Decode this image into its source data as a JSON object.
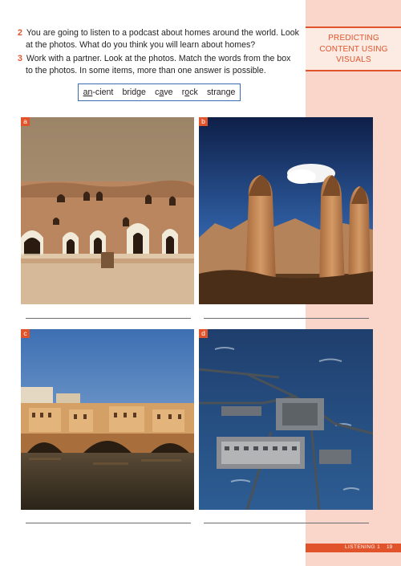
{
  "sidebar": {
    "label_lines": [
      "PREDICTING",
      "CONTENT USING",
      "VISUALS"
    ],
    "footer_label": "LISTENING 1",
    "page_number": "19"
  },
  "questions": [
    {
      "number": "2",
      "line1": "You are going to listen to a podcast about homes around the world. Look",
      "line2": "at the photos. What do you think you will learn about homes?"
    },
    {
      "number": "3",
      "line1": "Work with a partner. Look at the photos. Match the words from the box",
      "line2": "to the photos. In some items, more than one answer is possible."
    }
  ],
  "word_box": {
    "words": [
      {
        "pre": "",
        "u": "an",
        "post": "-cient"
      },
      {
        "pre": "",
        "u": "",
        "post": "bridge"
      },
      {
        "pre": "c",
        "u": "a",
        "post": "ve"
      },
      {
        "pre": "r",
        "u": "o",
        "post": "ck"
      },
      {
        "pre": "stran",
        "u": "",
        "post": "ge"
      }
    ]
  },
  "photos": {
    "a": {
      "label": "a"
    },
    "b": {
      "label": "b"
    },
    "c": {
      "label": "c"
    },
    "d": {
      "label": "d"
    }
  },
  "colors": {
    "accent": "#e1542b",
    "sidebar": "#f9d6c9",
    "box_border": "#3b6bb0"
  }
}
